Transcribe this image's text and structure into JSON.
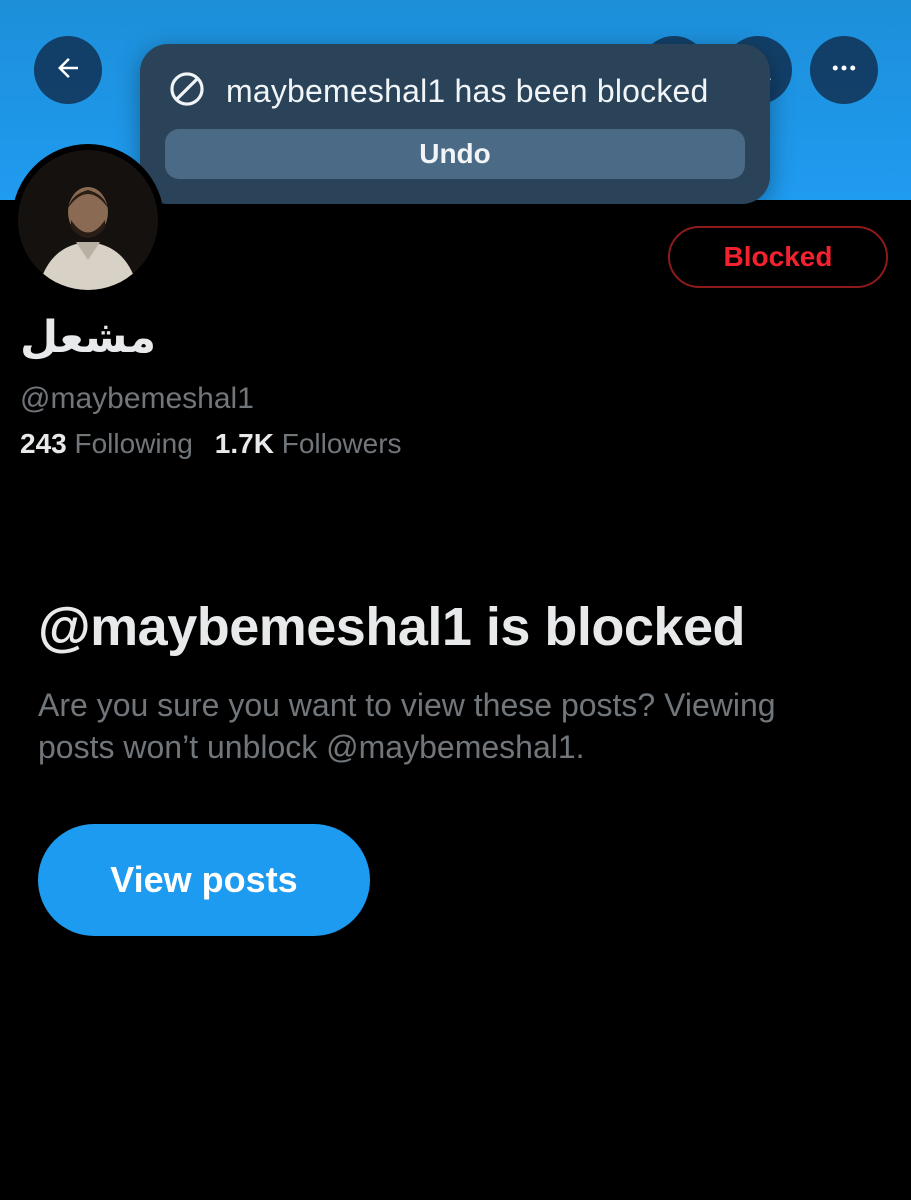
{
  "header": {
    "back_icon": "arrow-left-icon",
    "search_icon": "search-icon",
    "more_icon": "more-horizontal-icon"
  },
  "toast": {
    "icon": "block-icon",
    "message": "maybemeshal1 has been blocked",
    "undo_label": "Undo"
  },
  "profile": {
    "display_name": "مشعل",
    "handle": "@maybemeshal1",
    "following_count": "243",
    "following_label": "Following",
    "followers_count": "1.7K",
    "followers_label": "Followers",
    "blocked_button_label": "Blocked"
  },
  "blocked_notice": {
    "title": "@maybemeshal1 is blocked",
    "description": "Are you sure you want to view these posts? Viewing posts won’t unblock @maybemeshal1.",
    "view_posts_label": "View posts"
  },
  "colors": {
    "banner": "#1f9bf0",
    "accent": "#1d9bf0",
    "blocked_red": "#f4212e",
    "muted_text": "#71767b"
  }
}
